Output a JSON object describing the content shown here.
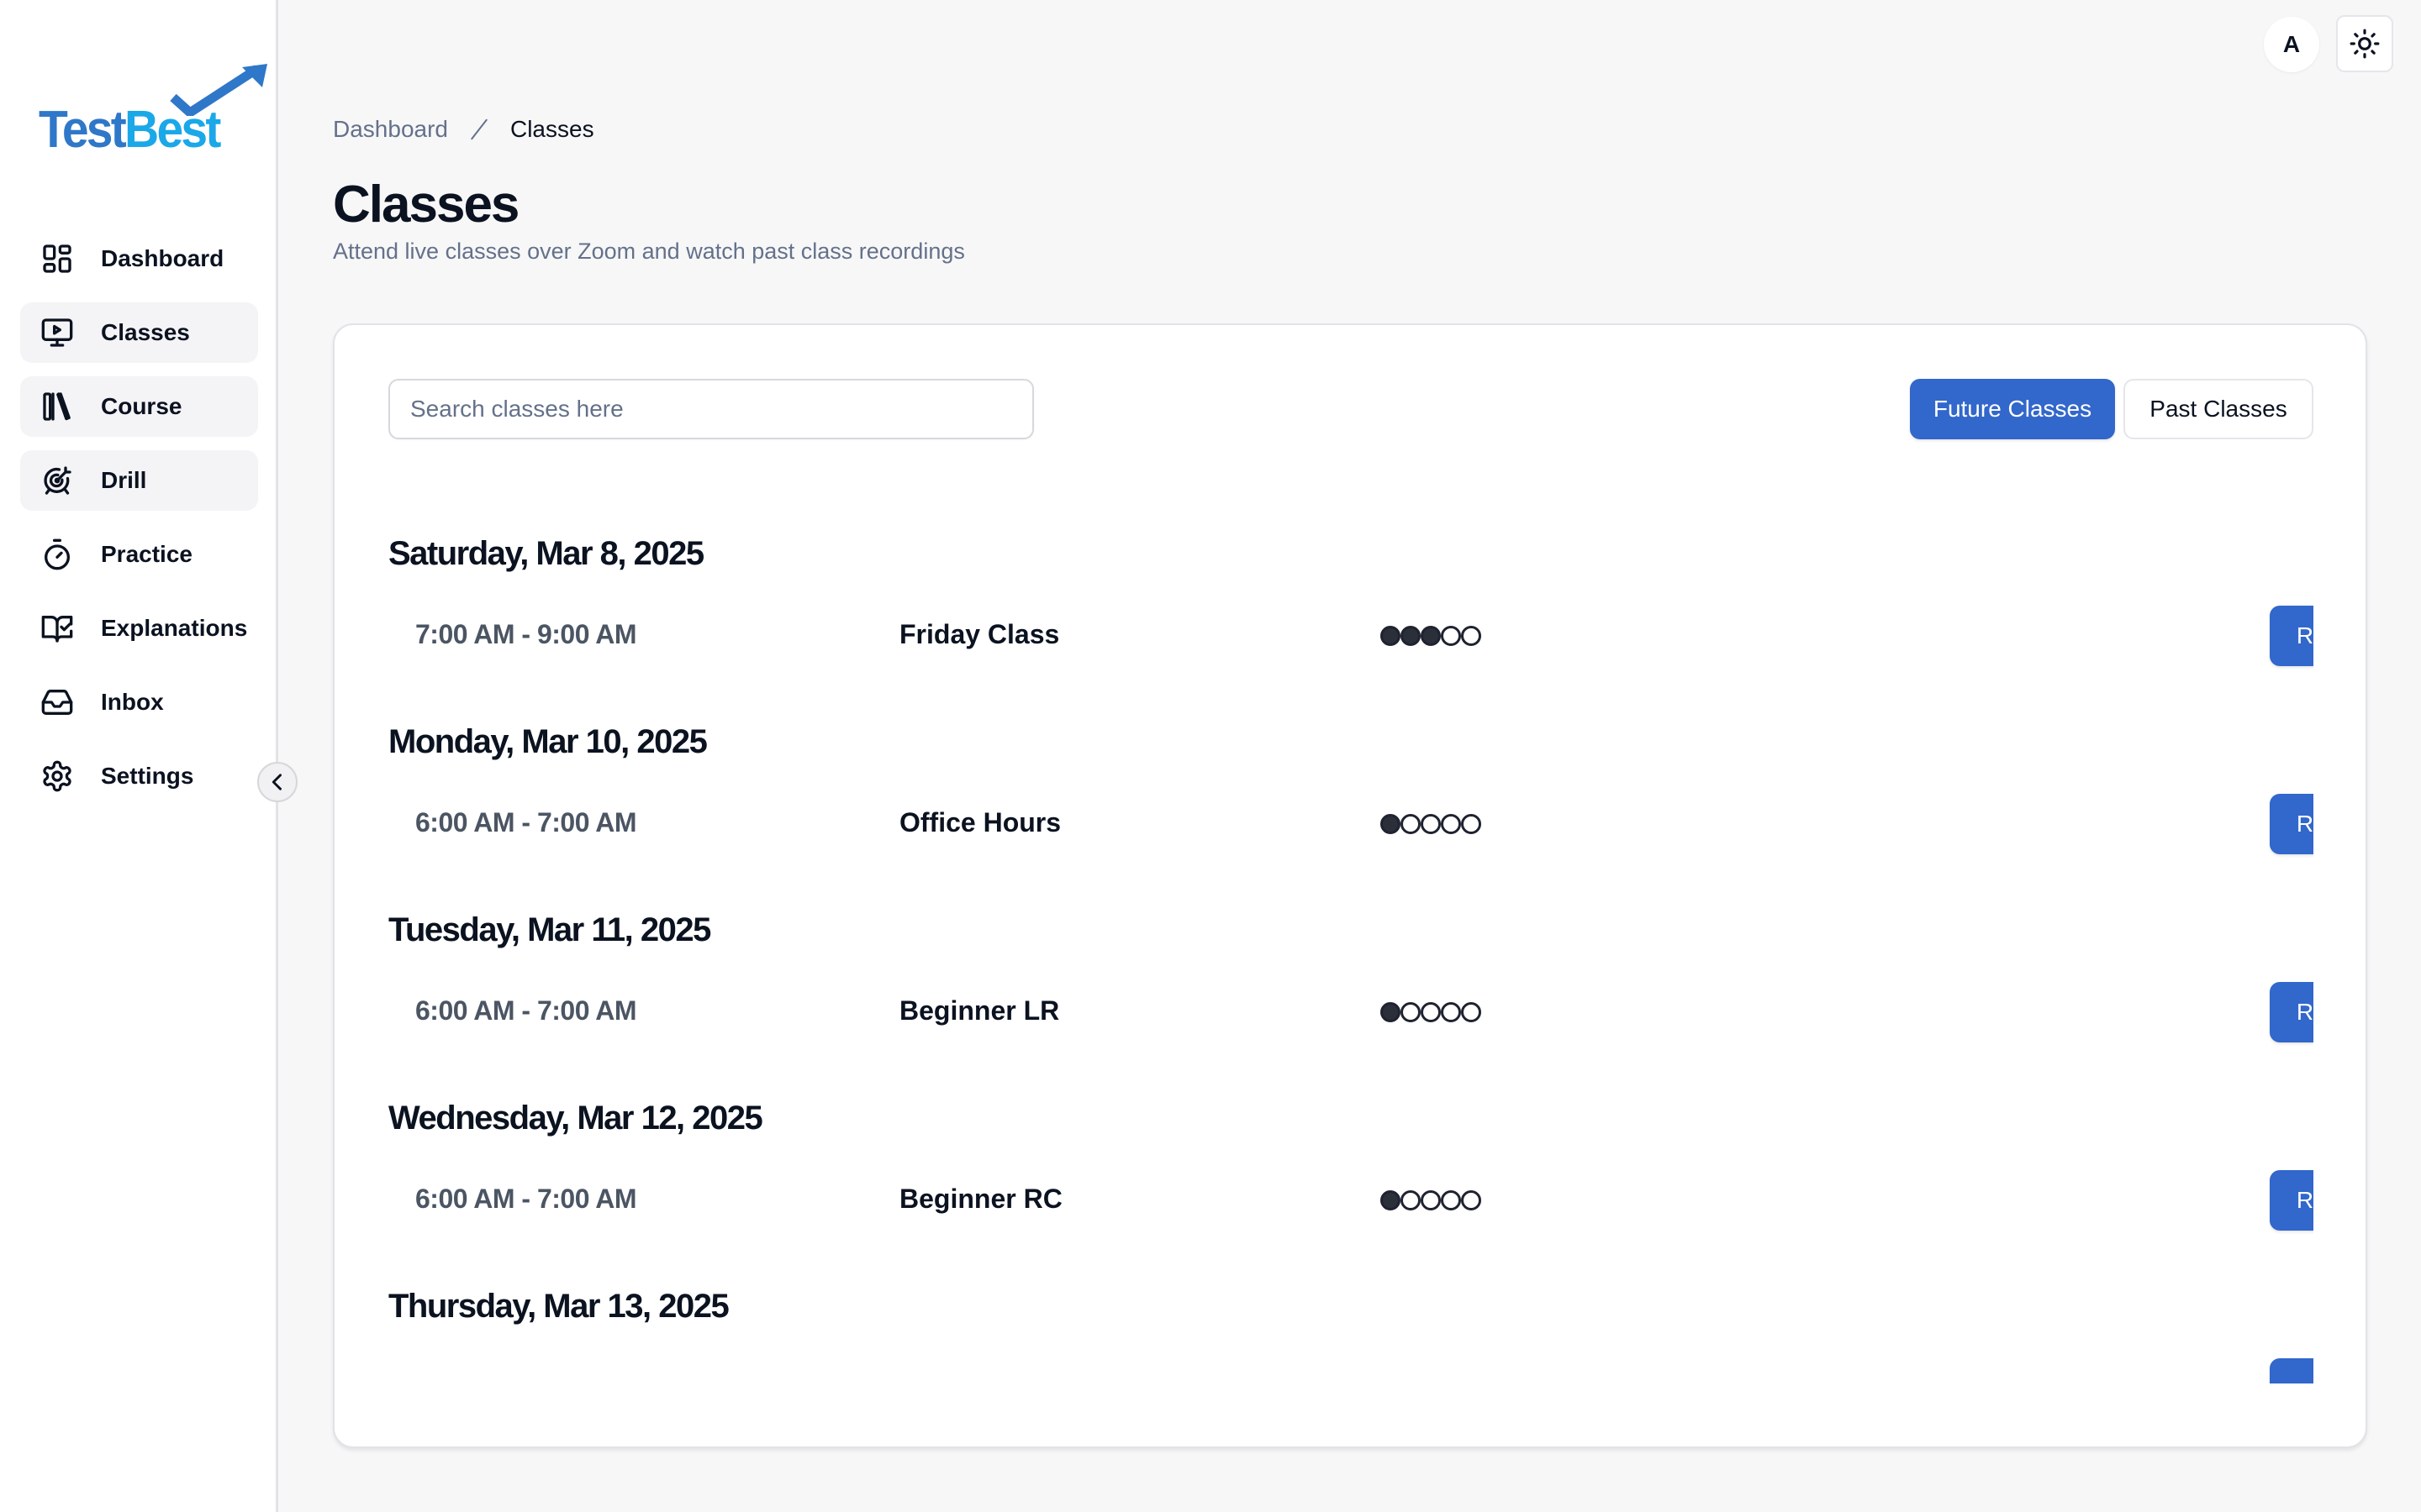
{
  "brand": {
    "name_part1": "Test",
    "name_part2": "Best",
    "colors": {
      "primary": "#2f77c8",
      "secondary": "#1aa8e8"
    }
  },
  "sidebar": {
    "items": [
      {
        "label": "Dashboard",
        "icon": "dashboard-grid-icon",
        "shaded": false
      },
      {
        "label": "Classes",
        "icon": "monitor-play-icon",
        "shaded": true
      },
      {
        "label": "Course",
        "icon": "library-books-icon",
        "shaded": true
      },
      {
        "label": "Drill",
        "icon": "target-arrow-icon",
        "shaded": true
      },
      {
        "label": "Practice",
        "icon": "stopwatch-icon",
        "shaded": false
      },
      {
        "label": "Explanations",
        "icon": "book-check-icon",
        "shaded": false
      },
      {
        "label": "Inbox",
        "icon": "inbox-icon",
        "shaded": false
      },
      {
        "label": "Settings",
        "icon": "gear-icon",
        "shaded": false
      }
    ],
    "collapse_icon": "chevron-left-icon"
  },
  "topbar": {
    "avatar_initial": "A",
    "theme_icon": "sun-icon"
  },
  "breadcrumb": {
    "items": [
      "Dashboard",
      "Classes"
    ]
  },
  "header": {
    "title": "Classes",
    "subtitle": "Attend live classes over Zoom and watch past class recordings"
  },
  "toolbar": {
    "search_placeholder": "Search classes here",
    "search_value": "",
    "future_label": "Future Classes",
    "past_label": "Past Classes",
    "active_tab": "Future Classes"
  },
  "colors": {
    "accent": "#3267cb",
    "background": "#f7f7f8",
    "muted_text": "#64718a"
  },
  "schedule": [
    {
      "date": "Saturday, Mar 8, 2025",
      "time": "7:00 AM - 9:00 AM",
      "name": "Friday Class",
      "level": 3,
      "level_max": 5,
      "action": "Register"
    },
    {
      "date": "Monday, Mar 10, 2025",
      "time": "6:00 AM - 7:00 AM",
      "name": "Office Hours",
      "level": 1,
      "level_max": 5,
      "action": "Register"
    },
    {
      "date": "Tuesday, Mar 11, 2025",
      "time": "6:00 AM - 7:00 AM",
      "name": "Beginner LR",
      "level": 1,
      "level_max": 5,
      "action": "Register"
    },
    {
      "date": "Wednesday, Mar 12, 2025",
      "time": "6:00 AM - 7:00 AM",
      "name": "Beginner RC",
      "level": 1,
      "level_max": 5,
      "action": "Register"
    },
    {
      "date": "Thursday, Mar 13, 2025",
      "time": "",
      "name": "",
      "level": null,
      "level_max": 5,
      "action": ""
    }
  ]
}
